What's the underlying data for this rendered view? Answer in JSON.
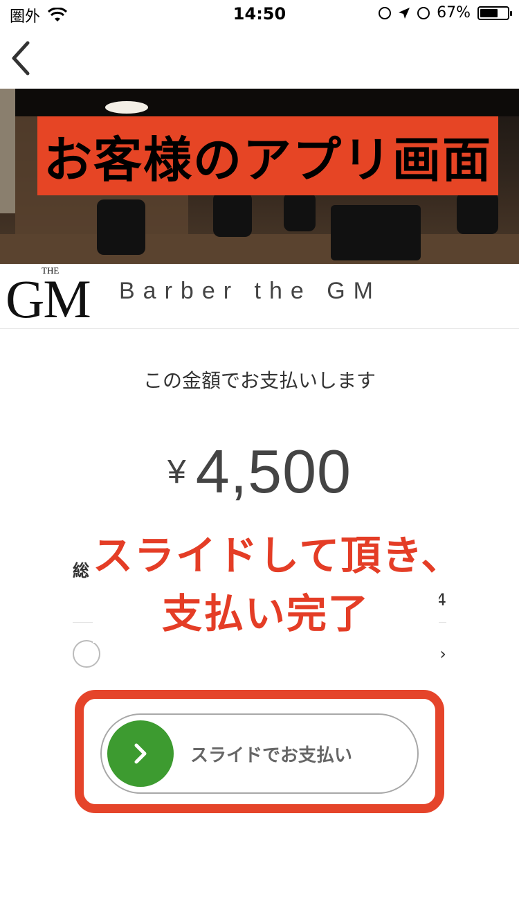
{
  "status_bar": {
    "carrier": "圏外",
    "time": "14:50",
    "battery": "67%",
    "battery_level": 0.67,
    "icons": [
      "wifi-icon",
      "rotation-lock-icon",
      "location-arrow-icon",
      "alarm-icon",
      "battery-icon"
    ]
  },
  "nav": {
    "back_icon": "chevron-left-icon"
  },
  "hero": {
    "banner_text": "お客様のアプリ画面"
  },
  "shop": {
    "logo_small": "THE",
    "logo_main": "GM",
    "name": "Barber the GM"
  },
  "payment": {
    "title": "この金額でお支払いします",
    "currency_symbol": "¥",
    "amount": "4,500",
    "total_label": "総",
    "total_value_partial": "4",
    "slide_label": "スライドでお支払い"
  },
  "annotation": {
    "line1": "スライドして頂き、",
    "line2": "支払い完了"
  },
  "colors": {
    "accent_red": "#e5442a",
    "slider_green": "#3d9b30"
  }
}
